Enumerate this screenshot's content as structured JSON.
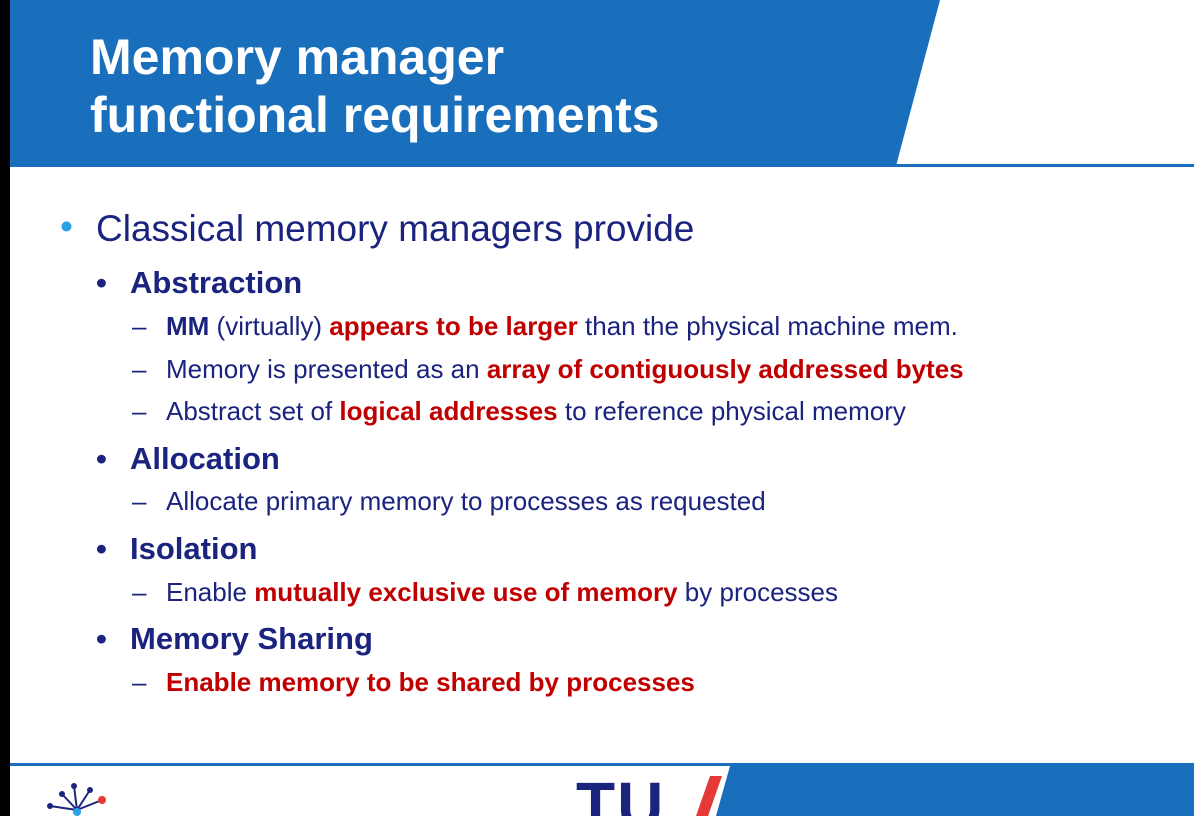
{
  "slide": {
    "title_line1": "Memory manager",
    "title_line2": "functional requirements",
    "intro": "Classical memory managers provide",
    "sections": [
      {
        "heading": "Abstraction",
        "items": [
          [
            "MM",
            " (virtually) ",
            "appears to be larger",
            " than the physical machine mem."
          ],
          [
            "Memory is presented as an ",
            "array of contiguously addressed bytes"
          ],
          [
            "Abstract set of ",
            "logical addresses",
            " to reference physical memory"
          ]
        ]
      },
      {
        "heading": "Allocation",
        "items": [
          [
            "Allocate primary memory to processes as requested"
          ]
        ]
      },
      {
        "heading": "Isolation",
        "items": [
          [
            "Enable ",
            "mutually exclusive use of memory",
            " by processes"
          ]
        ]
      },
      {
        "heading": "Memory Sharing",
        "items": [
          [
            "Enable memory to be shared by processes"
          ]
        ]
      }
    ],
    "footer_logo_text": "TU"
  },
  "colors": {
    "header_blue": "#1a6fbd",
    "text_navy": "#1a237e",
    "emphasis_red": "#c00000",
    "bullet_cyan": "#29a3e6"
  }
}
